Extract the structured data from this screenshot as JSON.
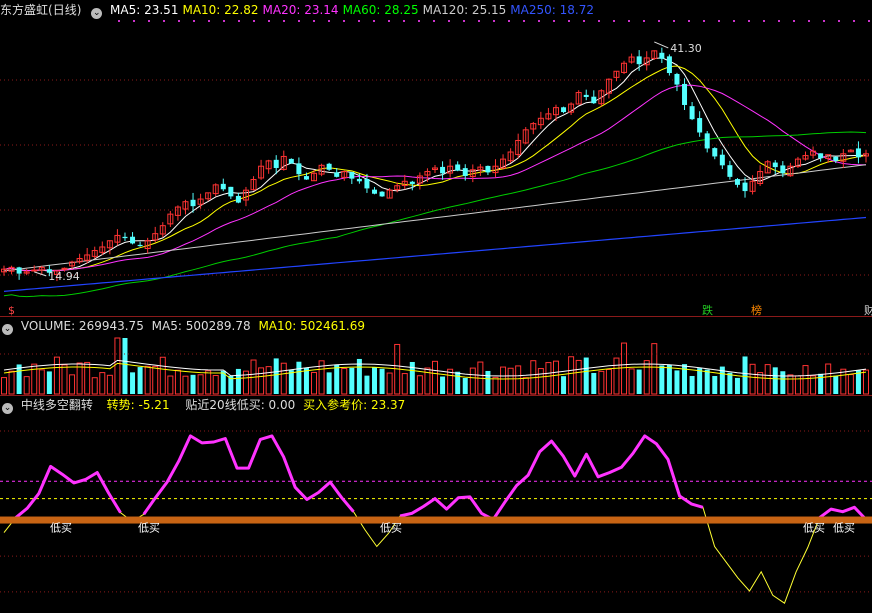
{
  "main": {
    "title": "东方盛虹",
    "period": "(日线)",
    "ma": [
      {
        "label": "MA5: 23.51",
        "color": "#ffffff"
      },
      {
        "label": "MA10: 22.82",
        "color": "#ffff00"
      },
      {
        "label": "MA20: 23.14",
        "color": "#ff33ff"
      },
      {
        "label": "MA60: 28.25",
        "color": "#00ff00"
      },
      {
        "label": "MA120: 25.15",
        "color": "#cccccc"
      },
      {
        "label": "MA250: 18.72",
        "color": "#3355ff"
      }
    ],
    "high_label": "41.30",
    "low_label": "14.94",
    "markers": [
      "$",
      "跌",
      "榜",
      "财"
    ]
  },
  "volume": {
    "label": "VOLUME: 269943.75",
    "ma5": "MA5: 500289.78",
    "ma10": "MA10: 502461.69"
  },
  "indicator": {
    "name": "中线多空翻转",
    "trend": "转势: -5.21",
    "near_low": "贴近20线低买: 0.00",
    "buy_ref": "买入参考价: 23.37",
    "buy_label": "低买"
  },
  "chart_data": {
    "type": "candlestick",
    "title": "东方盛虹 (日线)",
    "price_range": [
      12,
      44
    ],
    "high": 41.3,
    "low": 14.94,
    "closes": [
      15.7,
      15.9,
      15.2,
      15.4,
      15.6,
      15.9,
      15.3,
      15.5,
      15.8,
      16.5,
      16.9,
      17.3,
      17.8,
      18.2,
      18.9,
      19.5,
      19.2,
      18.6,
      18.3,
      18.9,
      19.7,
      20.6,
      21.9,
      22.7,
      23.3,
      22.8,
      23.6,
      24.3,
      25.2,
      24.7,
      23.9,
      23.2,
      24.6,
      25.8,
      27.3,
      27.9,
      27.1,
      28.4,
      27.6,
      26.4,
      25.8,
      26.5,
      27.4,
      26.9,
      26.1,
      26.7,
      25.9,
      25.6,
      24.8,
      24.2,
      23.9,
      24.6,
      25.1,
      25.6,
      25.3,
      26.2,
      26.7,
      27.1,
      26.5,
      27.3,
      26.8,
      26.2,
      26.9,
      27.2,
      26.6,
      27.3,
      28.1,
      28.9,
      30.2,
      31.4,
      32.1,
      32.7,
      33.2,
      33.9,
      33.4,
      34.3,
      35.6,
      35.1,
      34.4,
      35.8,
      37.1,
      38.0,
      38.9,
      39.6,
      38.8,
      39.5,
      40.3,
      39.4,
      37.8,
      36.5,
      34.2,
      32.6,
      31.1,
      29.3,
      28.4,
      27.4,
      26.1,
      25.2,
      24.5,
      25.6,
      26.7,
      27.8,
      27.2,
      26.5,
      27.3,
      28.1,
      28.5,
      29.0,
      28.2,
      28.6,
      27.9,
      28.7,
      29.1,
      28.3,
      28.7
    ],
    "volume_ma5": 500289.78,
    "volume_ma10": 502461.69,
    "volume_last": 269943.75,
    "indicator": {
      "name": "中线多空翻转",
      "values": [
        -1.5,
        0.2,
        1.3,
        3.0,
        6.1,
        5.2,
        4.2,
        4.6,
        5.4,
        3.0,
        0.8,
        -0.2,
        0.6,
        2.5,
        4.3,
        6.7,
        9.6,
        8.8,
        8.9,
        9.3,
        5.9,
        5.9,
        9.2,
        9.6,
        7.2,
        3.7,
        2.3,
        3.1,
        4.3,
        2.5,
        0.9,
        -1.2,
        -3.1,
        -1.6,
        0.4,
        0.7,
        1.5,
        2.4,
        1.2,
        2.5,
        2.6,
        0.7,
        0.0,
        2.0,
        3.9,
        5.1,
        7.8,
        9.0,
        7.3,
        5.0,
        7.5,
        4.9,
        5.4,
        6.0,
        7.6,
        9.6,
        8.7,
        6.9,
        2.7,
        1.8,
        1.4,
        -3.1,
        -4.9,
        -6.7,
        -8.2,
        -6.0,
        -8.7,
        -9.6,
        -6.0,
        -3.2,
        0.2,
        1.2,
        0.9,
        1.4,
        0.0
      ],
      "levels": {
        "upper": 4.4,
        "middle": 2.4,
        "low_band": 0
      },
      "range": [
        -10.5,
        12
      ]
    }
  }
}
